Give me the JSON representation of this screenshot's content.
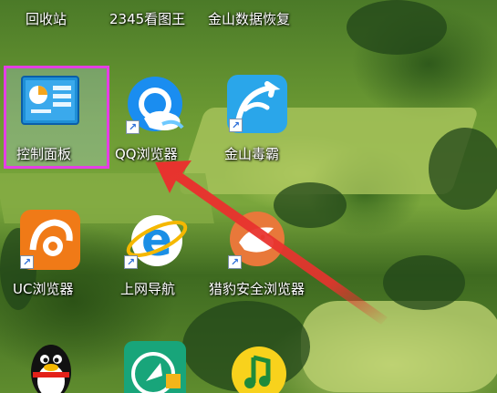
{
  "desktop": {
    "icons": [
      {
        "label": "回收站"
      },
      {
        "label": "2345看图王"
      },
      {
        "label": "金山数据恢复"
      },
      {
        "label": "控制面板"
      },
      {
        "label": "QQ浏览器"
      },
      {
        "label": "金山毒霸"
      },
      {
        "label": "UC浏览器"
      },
      {
        "label": "上网导航"
      },
      {
        "label": "猎豹安全浏览器"
      }
    ],
    "shortcut_glyph": "↗",
    "selection_color": "#e53ee6",
    "arrow_color": "#e8322e"
  }
}
